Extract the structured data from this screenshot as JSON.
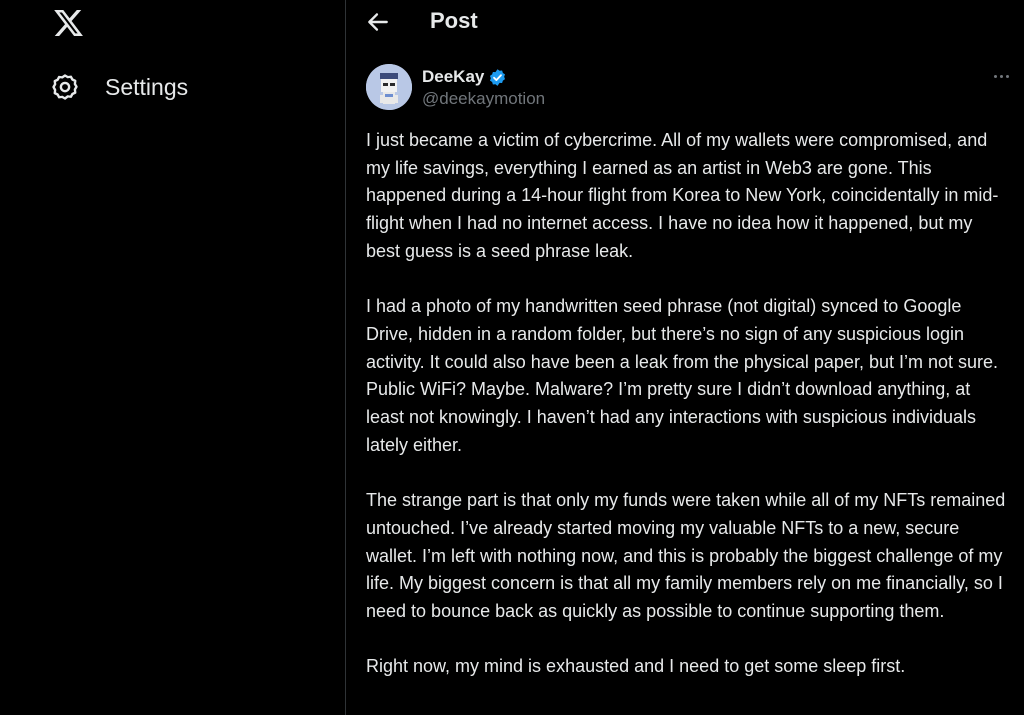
{
  "nav": {
    "logo_icon": "x-logo-icon",
    "settings_icon": "gear-icon",
    "settings_label": "Settings"
  },
  "header": {
    "back_icon": "arrow-left-icon",
    "title": "Post"
  },
  "post": {
    "author": {
      "display_name": "DeeKay",
      "handle": "@deekaymotion",
      "verified_icon": "verified-badge-icon"
    },
    "more_icon": "more-horizontal-icon",
    "paragraphs": [
      "I just became a victim of cybercrime. All of my wallets were compromised, and my life savings, everything I earned as an artist in Web3 are gone. This happened during a 14-hour flight from Korea to New York, coincidentally in mid-flight when I had no internet access. I have no idea how it happened, but my best guess is a seed phrase leak.",
      "I had a photo of my handwritten seed phrase (not digital) synced to Google Drive, hidden in a random folder, but there’s no sign of any suspicious login activity. It could also have been a leak from the physical paper, but I’m not sure. Public WiFi? Maybe. Malware? I’m pretty sure I didn’t download anything, at least not knowingly. I haven’t had any interactions with suspicious individuals lately either.",
      "The strange part is that only my funds were taken while all of my NFTs remained untouched. I’ve already started moving my valuable NFTs to a new, secure wallet. I’m left with nothing now, and this is probably the biggest challenge of my life. My biggest concern is that all my family members rely on me financially, so I need to bounce back as quickly as possible to continue supporting them.",
      "Right now, my mind is exhausted and I need to get some sleep first."
    ]
  },
  "colors": {
    "background": "#000000",
    "text_primary": "#e7e9ea",
    "text_secondary": "#71767b",
    "border": "#2f3336",
    "verified_blue": "#1d9bf0"
  }
}
